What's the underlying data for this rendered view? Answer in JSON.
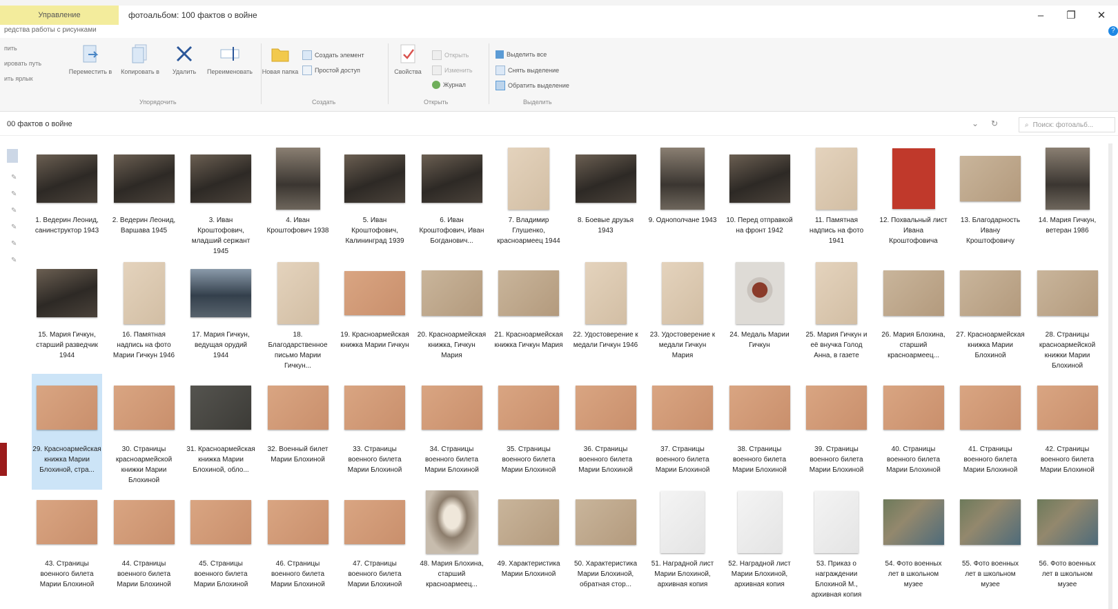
{
  "window": {
    "tool_tab": "Управление",
    "title": "фотоальбом: 100 фактов о войне",
    "subtab": "редства работы с рисунками",
    "controls": [
      "–",
      "❐",
      "✕"
    ],
    "help": "?"
  },
  "ribbon": {
    "left_items": [
      "пить",
      "ировать путь",
      "ить ярлык"
    ],
    "buttons": {
      "move_to": "Переместить в",
      "copy_to": "Копировать в",
      "delete": "Удалить",
      "rename": "Переименовать",
      "new_folder": "Новая папка",
      "properties": "Свойства"
    },
    "create_item": "Создать элемент",
    "easy_access": "Простой доступ",
    "open": "Открыть",
    "edit": "Изменить",
    "history": "Журнал",
    "select_all": "Выделить все",
    "select_none": "Снять выделение",
    "invert_selection": "Обратить выделение",
    "groups": [
      "Упорядочить",
      "Создать",
      "Открыть",
      "Выделить"
    ]
  },
  "address": {
    "path": "00 фактов о войне",
    "search_placeholder": "Поиск: фотоальб..."
  },
  "files": [
    {
      "caption": "1. Ведерин Леонид, санинструктор 1943",
      "thumb": "photo"
    },
    {
      "caption": "2. Ведерин Леонид, Варшава 1945",
      "thumb": "photo"
    },
    {
      "caption": "3. Иван Кроштофович, младший сержант 1945",
      "thumb": "photo"
    },
    {
      "caption": "4. Иван Кроштофович 1938",
      "thumb": "photo2"
    },
    {
      "caption": "5. Иван Кроштофович, Калининград 1939",
      "thumb": "photo"
    },
    {
      "caption": "6. Иван Кроштофович, Иван Богданович...",
      "thumb": "photo"
    },
    {
      "caption": "7. Владимир Глушенко, красноармеец 1944",
      "thumb": "doc"
    },
    {
      "caption": "8. Боевые друзья 1943",
      "thumb": "photo"
    },
    {
      "caption": "9. Однополчане 1943",
      "thumb": "photo2"
    },
    {
      "caption": "10. Перед отправкой на фронт 1942",
      "thumb": "photo"
    },
    {
      "caption": "11. Памятная надпись на фото 1941",
      "thumb": "doc"
    },
    {
      "caption": "12. Похвальный лист Ивана Кроштофовича",
      "thumb": "red"
    },
    {
      "caption": "13. Благодарность Ивану Кроштофовичу",
      "thumb": "card2"
    },
    {
      "caption": "14. Мария Гичкун, ветеран 1986",
      "thumb": "photo2"
    },
    {
      "caption": "15. Мария Гичкун, старший разведчик 1944",
      "thumb": "photo"
    },
    {
      "caption": "16. Памятная надпись на фото Марии Гичкун 1946",
      "thumb": "doc"
    },
    {
      "caption": "17. Мария Гичкун, ведущая орудий 1944",
      "thumb": "ship"
    },
    {
      "caption": "18. Благодарственное письмо Марии Гичкун...",
      "thumb": "doc"
    },
    {
      "caption": "19. Красноармейская книжка Марии Гичкун",
      "thumb": "card"
    },
    {
      "caption": "20. Красноармейская книжка, Гичкун Мария",
      "thumb": "card2"
    },
    {
      "caption": "21. Красноармейская книжка Гичкун Мария",
      "thumb": "card2"
    },
    {
      "caption": "22. Удостоверение к медали Гичкун 1946",
      "thumb": "doc"
    },
    {
      "caption": "23. Удостоверение к медали Гичкун Мария",
      "thumb": "doc"
    },
    {
      "caption": "24. Медаль Марии Гичкун",
      "thumb": "medal"
    },
    {
      "caption": "25. Мария Гичкун и её внучка Голод Анна, в газете",
      "thumb": "doc"
    },
    {
      "caption": "26. Мария Блохина, старший красноармеец...",
      "thumb": "card2"
    },
    {
      "caption": "27. Красноармейская книжка Марии Блохиной",
      "thumb": "card2"
    },
    {
      "caption": "28. Страницы красноармейской книжки Марии Блохиной",
      "thumb": "card2"
    },
    {
      "caption": "29. Красноармейская книжка Марии Блохиной, стра...",
      "thumb": "card",
      "selected": true
    },
    {
      "caption": "30. Страницы красноармейской книжки Марии Блохиной",
      "thumb": "card"
    },
    {
      "caption": "31. Красноармейская книжка Марии Блохиной, обло...",
      "thumb": "dark"
    },
    {
      "caption": "32. Военный билет Марии Блохиной",
      "thumb": "card"
    },
    {
      "caption": "33. Страницы военного билета Марии Блохиной",
      "thumb": "card"
    },
    {
      "caption": "34. Страницы военного билета Марии Блохиной",
      "thumb": "card"
    },
    {
      "caption": "35. Страницы военного билета Марии Блохиной",
      "thumb": "card"
    },
    {
      "caption": "36. Страницы военного билета Марии Блохиной",
      "thumb": "card"
    },
    {
      "caption": "37. Страницы военного билета Марии Блохиной",
      "thumb": "card"
    },
    {
      "caption": "38. Страницы военного билета Марии Блохиной",
      "thumb": "card"
    },
    {
      "caption": "39. Страницы военного билета Марии Блохиной",
      "thumb": "card"
    },
    {
      "caption": "40. Страницы военного билета Марии Блохиной",
      "thumb": "card"
    },
    {
      "caption": "41. Страницы военного билета Марии Блохиной",
      "thumb": "card"
    },
    {
      "caption": "42. Страницы военного билета Марии Блохиной",
      "thumb": "card"
    },
    {
      "caption": "43. Страницы военного билета Марии Блохиной",
      "thumb": "card"
    },
    {
      "caption": "44. Страницы военного билета Марии Блохиной",
      "thumb": "card"
    },
    {
      "caption": "45. Страницы военного билета Марии Блохиной",
      "thumb": "card"
    },
    {
      "caption": "46. Страницы военного билета Марии Блохиной",
      "thumb": "card"
    },
    {
      "caption": "47. Страницы военного билета Марии Блохиной",
      "thumb": "card"
    },
    {
      "caption": "48. Мария Блохина, старший красноармеец...",
      "thumb": "portrait"
    },
    {
      "caption": "49. Характеристика Марии Блохиной",
      "thumb": "card2"
    },
    {
      "caption": "50. Характеристика Марии Блохиной, обратная стор...",
      "thumb": "card2"
    },
    {
      "caption": "51. Наградной лист Марии Блохиной, архивная копия",
      "thumb": "white"
    },
    {
      "caption": "52. Наградной лист Марии Блохиной, архивная копия",
      "thumb": "white"
    },
    {
      "caption": "53. Приказ о награждении Блохиной М., архивная копия",
      "thumb": "white"
    },
    {
      "caption": "54. Фото военных лет в школьном музее",
      "thumb": "color"
    },
    {
      "caption": "55. Фото военных лет в школьном музее",
      "thumb": "color"
    },
    {
      "caption": "56. Фото военных лет в школьном музее",
      "thumb": "color"
    }
  ]
}
